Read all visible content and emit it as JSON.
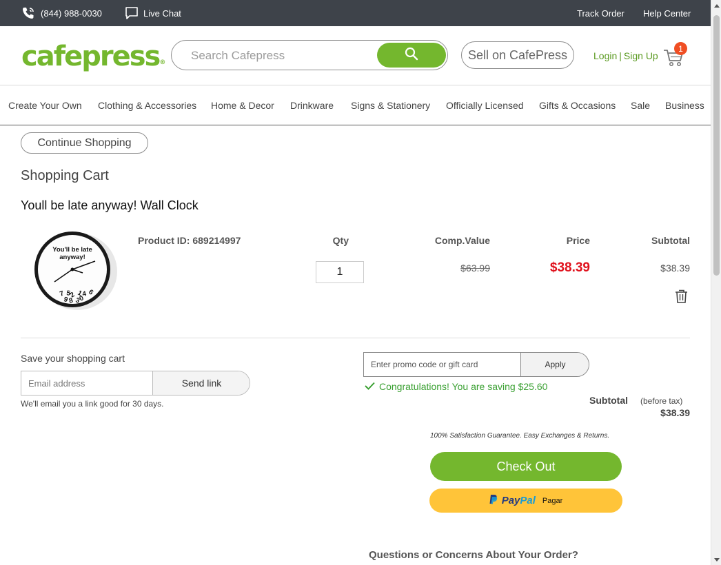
{
  "topbar": {
    "phone": "(844) 988-0030",
    "chat": "Live Chat",
    "track_order": "Track Order",
    "help_center": "Help Center"
  },
  "header": {
    "logo": "cafepress",
    "search_placeholder": "Search Cafepress",
    "sell": "Sell on CafePress",
    "login": "Login",
    "separator": "|",
    "signup": "Sign Up",
    "cart_count": "1"
  },
  "nav": {
    "items": [
      "Create Your Own",
      "Clothing & Accessories",
      "Home & Decor",
      "Drinkware",
      "Signs & Stationery",
      "Officially Licensed",
      "Gifts & Occasions",
      "Sale",
      "Business"
    ]
  },
  "cart": {
    "continue_label": "Continue Shopping",
    "title": "Shopping Cart",
    "product_name": "Youll be late anyway! Wall Clock",
    "product_id": "Product ID: 689214997",
    "image_text": [
      "You'll be late",
      "anyway!"
    ],
    "headers": {
      "qty": "Qty",
      "comp_value": "Comp.Value",
      "price": "Price",
      "subtotal": "Subtotal"
    },
    "qty": "1",
    "comp_value": "$63.99",
    "price": "$38.39",
    "subtotal": "$38.39"
  },
  "save_cart": {
    "title": "Save your shopping cart",
    "email_placeholder": "Email address",
    "send_label": "Send link",
    "note": "We'll email you a link good for 30 days."
  },
  "promo": {
    "placeholder": "Enter promo code or gift card",
    "apply_label": "Apply",
    "saving_message": "Congratulations! You are saving $25.60"
  },
  "summary": {
    "subtotal_label": "Subtotal",
    "before_tax": "(before tax)",
    "subtotal_value": "$38.39",
    "guarantee": "100% Satisfaction Guarantee. Easy Exchanges & Returns.",
    "checkout_label": "Check Out",
    "paypal_pay": "Pay",
    "paypal_pal": "Pal",
    "paypal_text": "Pagar"
  },
  "footer": {
    "questions": "Questions or Concerns About Your Order?"
  },
  "colors": {
    "brand_green": "#74b72e",
    "price_red": "#e0121d",
    "topbar": "#3e434a",
    "paypal_yellow": "#ffc439",
    "badge_orange": "#f04e23"
  }
}
